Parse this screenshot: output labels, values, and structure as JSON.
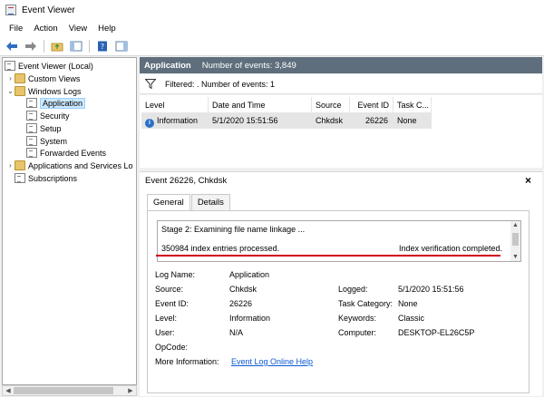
{
  "window": {
    "title": "Event Viewer"
  },
  "menu": [
    "File",
    "Action",
    "View",
    "Help"
  ],
  "toolbar": {
    "icons": [
      "back-arrow-icon",
      "forward-arrow-icon",
      "up-folder-icon",
      "show-hide-tree-icon",
      "help-icon",
      "properties-icon"
    ]
  },
  "tree": {
    "root": "Event Viewer (Local)",
    "custom_views": "Custom Views",
    "windows_logs": "Windows Logs",
    "logs": [
      "Application",
      "Security",
      "Setup",
      "System",
      "Forwarded Events"
    ],
    "apps_services": "Applications and Services Lo",
    "subscriptions": "Subscriptions"
  },
  "pane": {
    "name": "Application",
    "count": "Number of events: 3,849",
    "filter": "Filtered: . Number of events: 1"
  },
  "grid": {
    "columns": [
      "Level",
      "Date and Time",
      "Source",
      "Event ID",
      "Task C..."
    ],
    "rows": [
      {
        "level": "Information",
        "datetime": "5/1/2020 15:51:56",
        "source": "Chkdsk",
        "event_id": "26226",
        "task": "None"
      }
    ]
  },
  "detail": {
    "title": "Event 26226, Chkdsk",
    "close": "×",
    "tabs": [
      "General",
      "Details"
    ],
    "description": {
      "line1": "Stage 2: Examining file name linkage ...",
      "line2_left": "350984 index entries processed.",
      "line2_right": "Index verification completed."
    },
    "fields": {
      "log_name_label": "Log Name:",
      "log_name": "Application",
      "source_label": "Source:",
      "source": "Chkdsk",
      "logged_label": "Logged:",
      "logged": "5/1/2020 15:51:56",
      "event_id_label": "Event ID:",
      "event_id": "26226",
      "task_category_label": "Task Category:",
      "task_category": "None",
      "level_label": "Level:",
      "level": "Information",
      "keywords_label": "Keywords:",
      "keywords": "Classic",
      "user_label": "User:",
      "user": "N/A",
      "computer_label": "Computer:",
      "computer": "DESKTOP-EL26C5P",
      "opcode_label": "OpCode:",
      "opcode": "",
      "more_info_label": "More Information:",
      "more_info_link": "Event Log Online Help"
    }
  },
  "colors": {
    "header_bg": "#5e6e7c",
    "selection": "#cce8ff",
    "link": "#0b5ad5",
    "underline": "#d0021b"
  }
}
